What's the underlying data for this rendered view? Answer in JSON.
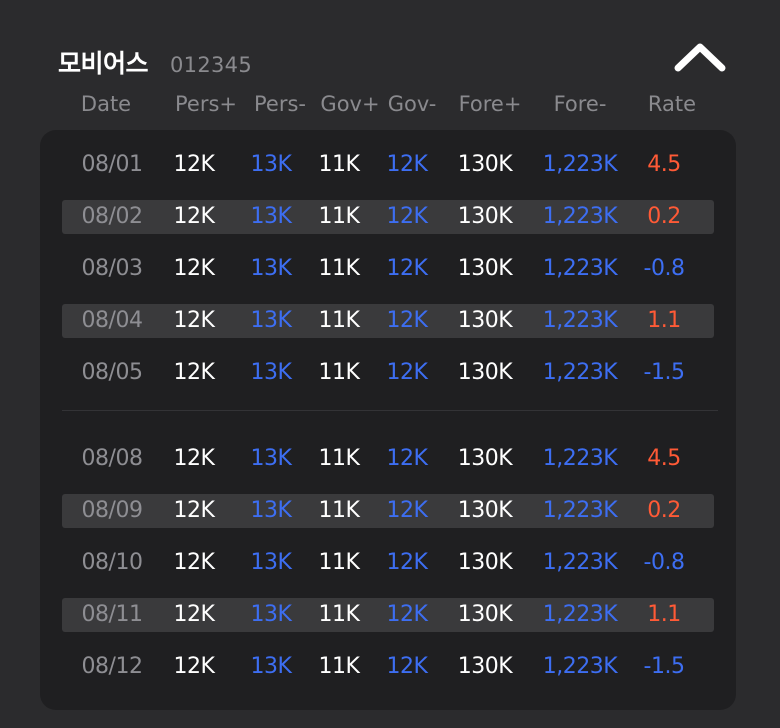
{
  "header": {
    "title": "모비어스",
    "code": "012345"
  },
  "columns": [
    "Date",
    "Pers+",
    "Pers-",
    "Gov+",
    "Gov-",
    "Fore+",
    "Fore-",
    "Rate"
  ],
  "colors": {
    "background": "#2b2b2d",
    "panel": "#1f1f21",
    "stripe": "#3a3a3c",
    "positive": "#ffffff",
    "negative": "#3d6ef2",
    "rate_up": "#ff5a36",
    "rate_down": "#3d6ef2"
  },
  "icons": {
    "collapse": "chevron-up-icon"
  },
  "groups": [
    {
      "rows": [
        {
          "date": "08/01",
          "pers_plus": "12K",
          "pers_minus": "13K",
          "gov_plus": "11K",
          "gov_minus": "12K",
          "fore_plus": "130K",
          "fore_minus": "1,223K",
          "rate": "4.5",
          "rate_dir": "up"
        },
        {
          "date": "08/02",
          "pers_plus": "12K",
          "pers_minus": "13K",
          "gov_plus": "11K",
          "gov_minus": "12K",
          "fore_plus": "130K",
          "fore_minus": "1,223K",
          "rate": "0.2",
          "rate_dir": "up"
        },
        {
          "date": "08/03",
          "pers_plus": "12K",
          "pers_minus": "13K",
          "gov_plus": "11K",
          "gov_minus": "12K",
          "fore_plus": "130K",
          "fore_minus": "1,223K",
          "rate": "-0.8",
          "rate_dir": "down"
        },
        {
          "date": "08/04",
          "pers_plus": "12K",
          "pers_minus": "13K",
          "gov_plus": "11K",
          "gov_minus": "12K",
          "fore_plus": "130K",
          "fore_minus": "1,223K",
          "rate": "1.1",
          "rate_dir": "up"
        },
        {
          "date": "08/05",
          "pers_plus": "12K",
          "pers_minus": "13K",
          "gov_plus": "11K",
          "gov_minus": "12K",
          "fore_plus": "130K",
          "fore_minus": "1,223K",
          "rate": "-1.5",
          "rate_dir": "down"
        }
      ]
    },
    {
      "rows": [
        {
          "date": "08/08",
          "pers_plus": "12K",
          "pers_minus": "13K",
          "gov_plus": "11K",
          "gov_minus": "12K",
          "fore_plus": "130K",
          "fore_minus": "1,223K",
          "rate": "4.5",
          "rate_dir": "up"
        },
        {
          "date": "08/09",
          "pers_plus": "12K",
          "pers_minus": "13K",
          "gov_plus": "11K",
          "gov_minus": "12K",
          "fore_plus": "130K",
          "fore_minus": "1,223K",
          "rate": "0.2",
          "rate_dir": "up"
        },
        {
          "date": "08/10",
          "pers_plus": "12K",
          "pers_minus": "13K",
          "gov_plus": "11K",
          "gov_minus": "12K",
          "fore_plus": "130K",
          "fore_minus": "1,223K",
          "rate": "-0.8",
          "rate_dir": "down"
        },
        {
          "date": "08/11",
          "pers_plus": "12K",
          "pers_minus": "13K",
          "gov_plus": "11K",
          "gov_minus": "12K",
          "fore_plus": "130K",
          "fore_minus": "1,223K",
          "rate": "1.1",
          "rate_dir": "up"
        },
        {
          "date": "08/12",
          "pers_plus": "12K",
          "pers_minus": "13K",
          "gov_plus": "11K",
          "gov_minus": "12K",
          "fore_plus": "130K",
          "fore_minus": "1,223K",
          "rate": "-1.5",
          "rate_dir": "down"
        }
      ]
    }
  ]
}
